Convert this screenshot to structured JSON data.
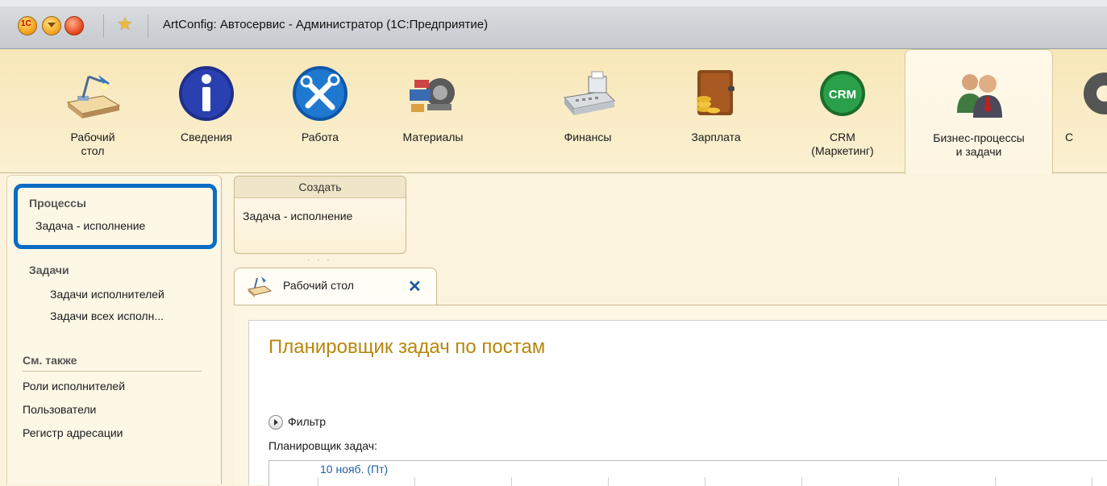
{
  "window": {
    "title": "ArtConfig: Автосервис - Администратор  (1С:Предприятие)",
    "logo_text": "1С"
  },
  "sections": [
    {
      "label": "Рабочий стол",
      "line1": "Рабочий",
      "line2": "стол",
      "icon": "desk-lamp-icon"
    },
    {
      "label": "Сведения",
      "line1": "Сведения",
      "line2": "",
      "icon": "info-icon"
    },
    {
      "label": "Работа",
      "line1": "Работа",
      "line2": "",
      "icon": "tools-icon"
    },
    {
      "label": "Материалы",
      "line1": "Материалы",
      "line2": "",
      "icon": "car-parts-icon"
    },
    {
      "label": "Финансы",
      "line1": "Финансы",
      "line2": "",
      "icon": "cash-register-icon"
    },
    {
      "label": "Зарплата",
      "line1": "Зарплата",
      "line2": "",
      "icon": "wallet-icon"
    },
    {
      "label": "CRM (Маркетинг)",
      "line1": "CRM",
      "line2": "(Маркетинг)",
      "icon": "crm-icon",
      "icon_text": "CRM"
    },
    {
      "label": "Бизнес-процессы и задачи",
      "line1": "Бизнес-процессы",
      "line2": "и задачи",
      "icon": "people-icon",
      "active": true
    },
    {
      "label": "С",
      "line1": "С",
      "line2": "",
      "icon": "gear-icon"
    }
  ],
  "nav": {
    "processes_header": "Процессы",
    "processes_item": "Задача - исполнение",
    "tasks_header": "Задачи",
    "tasks_item1": "Задачи исполнителей",
    "tasks_item2": "Задачи всех исполн...",
    "see_also_header": "См. также",
    "see_also_item1": "Роли исполнителей",
    "see_also_item2": "Пользователи",
    "see_also_item3": "Регистр адресации"
  },
  "create": {
    "header": "Создать",
    "item": "Задача - исполнение",
    "grip": "· · ·"
  },
  "tab": {
    "label": "Рабочий стол",
    "close": "✕"
  },
  "content": {
    "title": "Планировщик задач по постам",
    "filter": "Фильтр",
    "scheduler_label": "Планировщик задач:",
    "scheduler_date": "10 нояб. (Пт)"
  },
  "colors": {
    "highlight": "#0a6cc4",
    "title": "#b8860b",
    "date": "#1f5fa8"
  }
}
